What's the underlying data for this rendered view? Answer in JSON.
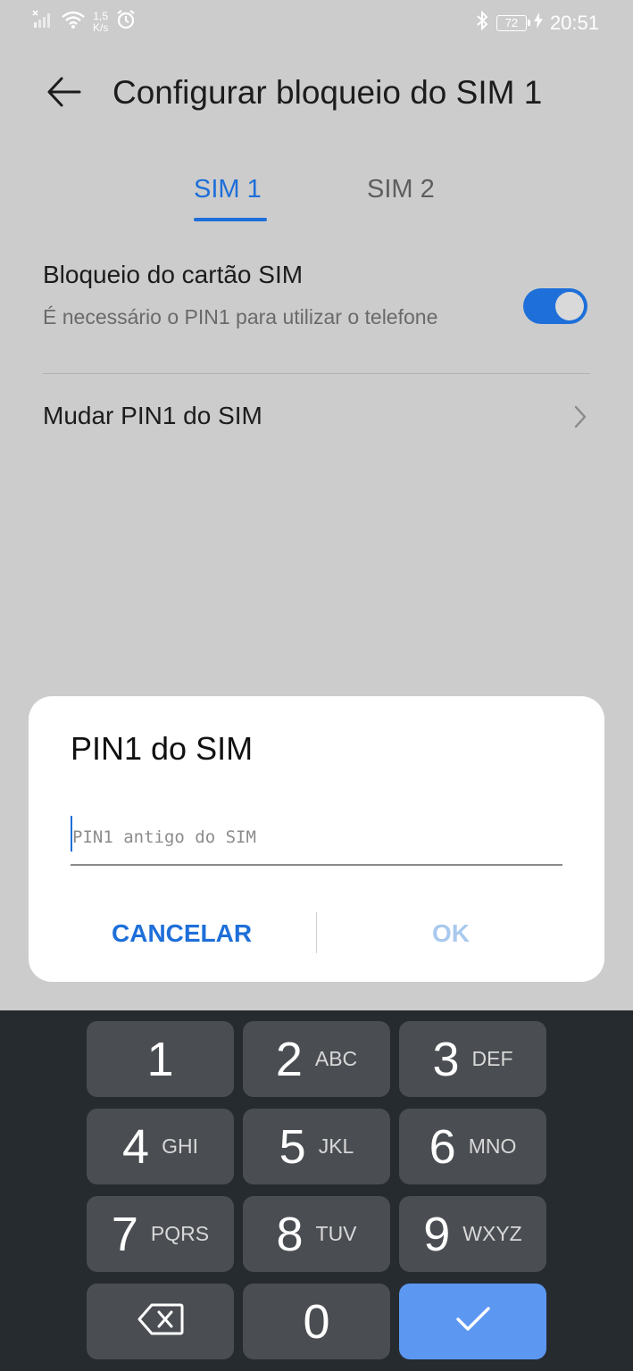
{
  "status_bar": {
    "speed_value": "1,5",
    "speed_unit": "K/s",
    "battery": "72",
    "time": "20:51"
  },
  "header": {
    "title": "Configurar bloqueio do SIM 1"
  },
  "tabs": [
    {
      "label": "SIM 1",
      "selected": true
    },
    {
      "label": "SIM 2",
      "selected": false
    }
  ],
  "settings": {
    "sim_lock": {
      "title": "Bloqueio do cartão SIM",
      "subtitle": "É necessário o PIN1 para utilizar o telefone",
      "enabled": true
    },
    "change_pin": {
      "title": "Mudar PIN1 do SIM"
    }
  },
  "dialog": {
    "title": "PIN1 do SIM",
    "input_placeholder": "PIN1 antigo do SIM",
    "input_value": "",
    "cancel_label": "CANCELAR",
    "ok_label": "OK"
  },
  "keypad": {
    "keys": [
      {
        "digit": "1",
        "letters": ""
      },
      {
        "digit": "2",
        "letters": "ABC"
      },
      {
        "digit": "3",
        "letters": "DEF"
      },
      {
        "digit": "4",
        "letters": "GHI"
      },
      {
        "digit": "5",
        "letters": "JKL"
      },
      {
        "digit": "6",
        "letters": "MNO"
      },
      {
        "digit": "7",
        "letters": "PQRS"
      },
      {
        "digit": "8",
        "letters": "TUV"
      },
      {
        "digit": "9",
        "letters": "WXYZ"
      },
      {
        "digit": "0",
        "letters": ""
      }
    ],
    "backspace_icon": "backspace-icon",
    "enter_icon": "checkmark-icon"
  },
  "colors": {
    "accent": "#1e6fd9",
    "background": "#cccccc",
    "keypad_bg": "#262b30",
    "key_bg": "#4a4d52",
    "enter_key_bg": "#5c98f2",
    "ok_disabled": "#a9c9ee"
  }
}
